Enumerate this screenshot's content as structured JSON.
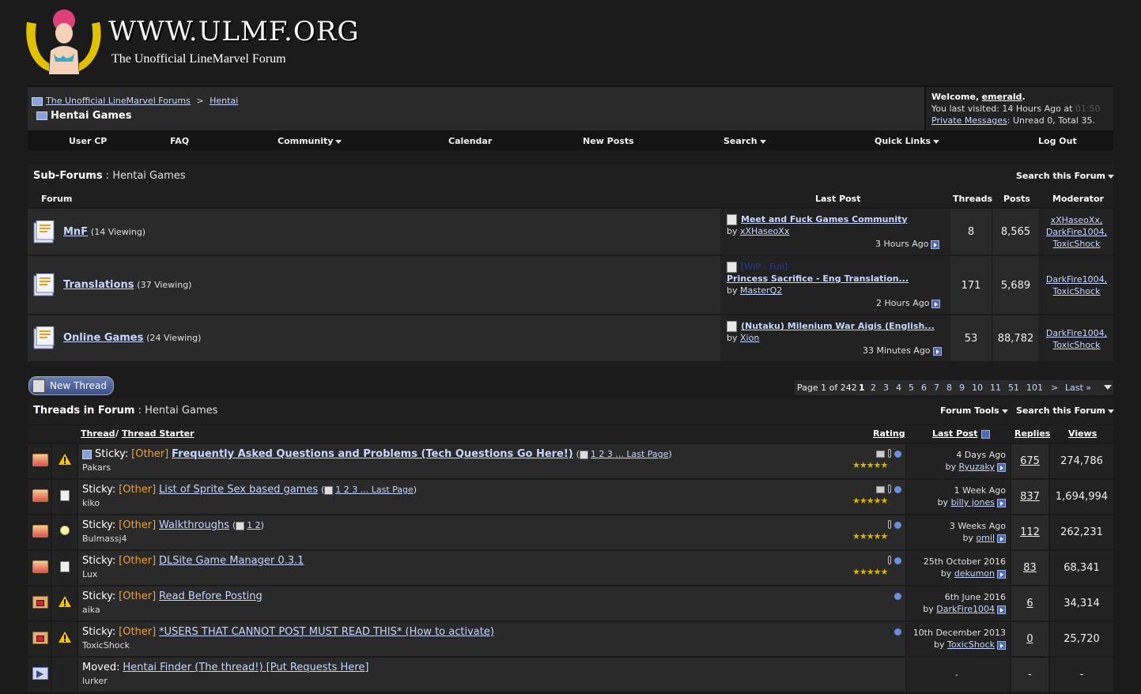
{
  "site": {
    "logo_title": "WWW.ULMF.ORG",
    "logo_subtitle": "The Unofficial LineMarvel Forum"
  },
  "breadcrumb": {
    "home": "The Unofficial LineMarvel Forums",
    "sep": ">",
    "parent": "Hentai",
    "current": "Hentai Games"
  },
  "welcome": {
    "prefix": "Welcome,",
    "user": "emerald",
    "suffix": ".",
    "last_visit": "You last visited: 14 Hours Ago at",
    "time": "01:50",
    "pm_link": "Private Messages",
    "pm_text": ": Unread 0, Total 35."
  },
  "nav": [
    "User CP",
    "FAQ",
    "Community",
    "Calendar",
    "New Posts",
    "Search",
    "Quick Links",
    "Log Out"
  ],
  "subforums": {
    "title": "Sub-Forums",
    "sep": ":",
    "forum": "Hentai Games",
    "search": "Search this Forum",
    "headers": {
      "forum": "Forum",
      "last_post": "Last Post",
      "threads": "Threads",
      "posts": "Posts",
      "moderator": "Moderator"
    },
    "rows": [
      {
        "name": "MnF",
        "viewing": "(14 Viewing)",
        "prefix": "",
        "lp_title": "Meet and Fuck Games Community",
        "by": "by",
        "lp_user": "xXHaseoXx",
        "lp_time": "3 Hours Ago",
        "threads": "8",
        "posts": "8,565",
        "mods": [
          "xXHaseoXx,",
          "DarkFire1004,",
          "ToxicShock"
        ]
      },
      {
        "name": "Translations",
        "viewing": "(37 Viewing)",
        "prefix": "[WIP - Full]",
        "lp_title": "Princess Sacrifice - Eng Translation...",
        "by": "by",
        "lp_user": "MasterQ2",
        "lp_time": "2 Hours Ago",
        "threads": "171",
        "posts": "5,689",
        "mods": [
          "DarkFire1004,",
          "ToxicShock"
        ]
      },
      {
        "name": "Online Games",
        "viewing": "(24 Viewing)",
        "prefix": "",
        "lp_title": "(Nutaku) Milenium War Aigis (English...",
        "by": "by",
        "lp_user": "Xion",
        "lp_time": "33 Minutes Ago",
        "threads": "53",
        "posts": "88,782",
        "mods": [
          "DarkFire1004,",
          "ToxicShock"
        ]
      }
    ]
  },
  "new_thread": "New Thread",
  "pager": {
    "label": "Page 1 of 242",
    "pages": [
      "1",
      "2",
      "3",
      "4",
      "5",
      "6",
      "7",
      "8",
      "9",
      "10",
      "11",
      "51",
      "101",
      ">",
      "Last »"
    ]
  },
  "threads": {
    "title": "Threads in Forum",
    "sep": ":",
    "forum": "Hentai Games",
    "tools": "Forum Tools",
    "search": "Search this Forum",
    "headers": {
      "thread": "Thread",
      "slash": "/",
      "starter": "Thread Starter",
      "rating": "Rating",
      "last_post": "Last Post",
      "replies": "Replies",
      "views": "Views"
    },
    "rows": [
      {
        "label": "Sticky:",
        "prefix": "[Other]",
        "title": "Frequently Asked Questions and Problems (Tech Questions Go Here!)",
        "pages": "1 2 3 ... Last Page",
        "starter": "Pakars",
        "stars": "★★★★★",
        "lp_time": "4 Days Ago",
        "lp_by": "by",
        "lp_user": "Ryuzaky",
        "replies": "675",
        "views": "274,786"
      },
      {
        "label": "Sticky:",
        "prefix": "[Other]",
        "title": "List of Sprite Sex based games",
        "pages": "1 2 3 ... Last Page",
        "starter": "kiko",
        "stars": "★★★★★",
        "lp_time": "1 Week Ago",
        "lp_by": "by",
        "lp_user": "billy jones",
        "replies": "837",
        "views": "1,694,994"
      },
      {
        "label": "Sticky:",
        "prefix": "[Other]",
        "title": "Walkthroughs",
        "pages": "1 2",
        "starter": "Bulmassj4",
        "stars": "★★★★★",
        "lp_time": "3 Weeks Ago",
        "lp_by": "by",
        "lp_user": "omil",
        "replies": "112",
        "views": "262,231"
      },
      {
        "label": "Sticky:",
        "prefix": "[Other]",
        "title": "DLSite Game Manager 0.3.1",
        "pages": "",
        "starter": "Lux",
        "stars": "★★★★★",
        "lp_time": "25th October 2016",
        "lp_by": "by",
        "lp_user": "dekumon",
        "replies": "83",
        "views": "68,341"
      },
      {
        "label": "Sticky:",
        "prefix": "[Other]",
        "title": "Read Before Posting",
        "pages": "",
        "starter": "aika",
        "stars": "",
        "lp_time": "6th June 2016",
        "lp_by": "by",
        "lp_user": "DarkFire1004",
        "replies": "6",
        "views": "34,314"
      },
      {
        "label": "Sticky:",
        "prefix": "[Other]",
        "title": "*USERS THAT CANNOT POST MUST READ THIS* (How to activate)",
        "pages": "",
        "starter": "ToxicShock",
        "stars": "",
        "lp_time": "10th December 2013",
        "lp_by": "by",
        "lp_user": "ToxicShock",
        "replies": "0",
        "views": "25,720"
      },
      {
        "label": "Moved:",
        "prefix": "",
        "title": "Hentai Finder (The thread!) [Put Requests Here]",
        "pages": "",
        "starter": "lurker",
        "stars": "",
        "lp_time": "-",
        "lp_by": "",
        "lp_user": "",
        "replies": "-",
        "views": "-"
      }
    ]
  }
}
